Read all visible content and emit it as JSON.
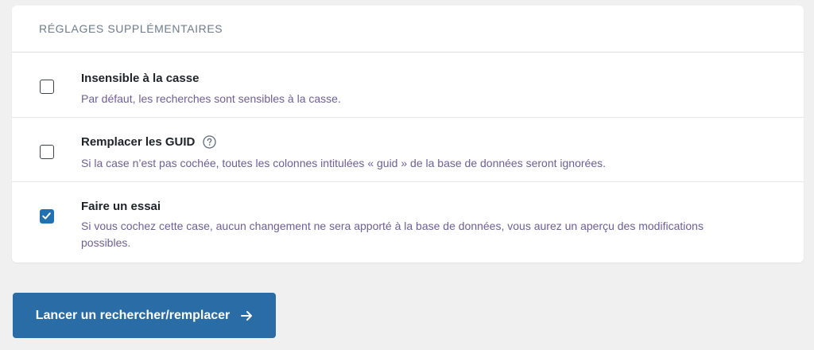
{
  "panel": {
    "title": "RÉGLAGES SUPPLÉMENTAIRES",
    "options": [
      {
        "label": "Insensible à la casse",
        "description": "Par défaut, les recherches sont sensibles à la casse.",
        "checked": false,
        "has_help_icon": false
      },
      {
        "label": "Remplacer les GUID",
        "description": "Si la case n’est pas cochée, toutes les colonnes intitulées « guid » de la base de données seront ignorées.",
        "checked": false,
        "has_help_icon": true,
        "help_icon": "question-circle-icon"
      },
      {
        "label": "Faire un essai",
        "description": "Si vous cochez cette case, aucun changement ne sera apporté à la base de données, vous aurez un aperçu des modifications possibles.",
        "checked": true,
        "has_help_icon": false
      }
    ]
  },
  "submit": {
    "label": "Lancer un rechercher/remplacer",
    "icon": "arrow-right-icon"
  },
  "colors": {
    "accent": "#2271b1",
    "button": "#2a6ca6",
    "description_text": "#6c5f98",
    "title_text": "#6d7b8b",
    "background": "#f0f0f1"
  }
}
